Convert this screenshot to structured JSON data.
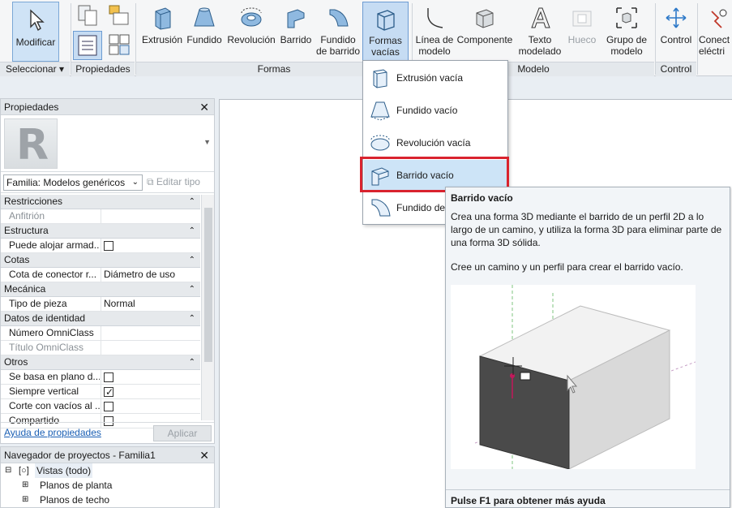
{
  "ribbon": {
    "select": {
      "modify_label": "Modificar",
      "panel_label": "Seleccionar"
    },
    "properties_panel_label": "Propiedades",
    "forms": {
      "panel_label": "Formas",
      "buttons": [
        "Extrusión",
        "Fundido",
        "Revolución",
        "Barrido"
      ],
      "swept_blend_line1": "Fundido",
      "swept_blend_line2": "de barrido",
      "void_line1": "Formas",
      "void_line2": "vacías"
    },
    "model": {
      "panel_label": "Modelo",
      "model_line_line1": "Línea de",
      "model_line_line2": "modelo",
      "component": "Componente",
      "model_text_line1": "Texto",
      "model_text_line2": "modelado",
      "opening": "Hueco",
      "model_group_line1": "Grupo de",
      "model_group_line2": "modelo"
    },
    "control": {
      "label": "Control",
      "panel_label": "Control"
    },
    "connector": {
      "line1": "Conect",
      "line2": "eléctri"
    }
  },
  "dropdown": {
    "items": [
      "Extrusión vacía",
      "Fundido vacío",
      "Revolución vacía",
      "Barrido vacío",
      "Fundido de"
    ]
  },
  "tooltip": {
    "title": "Barrido vacío",
    "description": "Crea una forma 3D mediante el barrido de un perfil 2D a lo largo de un camino, y utiliza la forma 3D para eliminar parte de una forma 3D sólida.",
    "hint": "Cree un camino y un perfil para crear el barrido vacío.",
    "footer": "Pulse F1 para obtener más ayuda"
  },
  "properties": {
    "title": "Propiedades",
    "family_selector": "Familia: Modelos genéricos",
    "edit_type": "Editar tipo",
    "help_link": "Ayuda de propiedades",
    "apply": "Aplicar",
    "logo_letter": "R",
    "rows": [
      {
        "type": "cat",
        "label": "Restricciones"
      },
      {
        "type": "row",
        "key": "Anfitrión",
        "value": "",
        "dim": true
      },
      {
        "type": "cat",
        "label": "Estructura"
      },
      {
        "type": "row",
        "key": "Puede alojar armad...",
        "check": false
      },
      {
        "type": "cat",
        "label": "Cotas"
      },
      {
        "type": "row",
        "key": "Cota de conector r...",
        "value": "Diámetro de uso"
      },
      {
        "type": "cat",
        "label": "Mecánica"
      },
      {
        "type": "row",
        "key": "Tipo de pieza",
        "value": "Normal"
      },
      {
        "type": "cat",
        "label": "Datos de identidad"
      },
      {
        "type": "row",
        "key": "Número OmniClass",
        "value": ""
      },
      {
        "type": "row",
        "key": "Título OmniClass",
        "value": "",
        "dim": true
      },
      {
        "type": "cat",
        "label": "Otros"
      },
      {
        "type": "row",
        "key": "Se basa en plano d...",
        "check": false
      },
      {
        "type": "row",
        "key": "Siempre vertical",
        "check": true
      },
      {
        "type": "row",
        "key": "Corte con vacíos al ...",
        "check": false
      },
      {
        "type": "row",
        "key": "Compartido",
        "check": false
      }
    ]
  },
  "browser": {
    "title": "Navegador de proyectos - Familia1",
    "nodes": [
      "Vistas (todo)",
      "Planos de planta",
      "Planos de techo"
    ]
  }
}
